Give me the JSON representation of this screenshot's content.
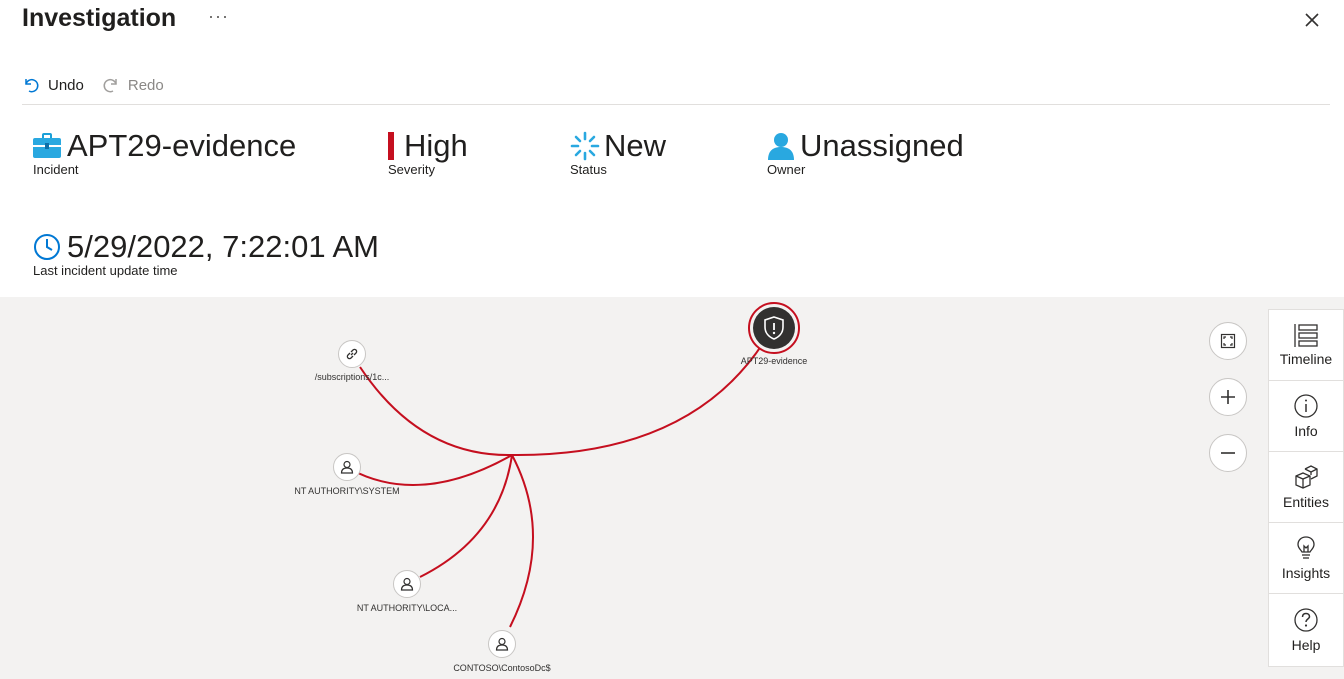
{
  "header": {
    "title": "Investigation",
    "more": "···"
  },
  "toolbar": {
    "undo": "Undo",
    "redo": "Redo"
  },
  "incident": {
    "name": "APT29-evidence",
    "name_label": "Incident",
    "severity": "High",
    "severity_label": "Severity",
    "severity_color": "#c50f1f",
    "status": "New",
    "status_label": "Status",
    "owner": "Unassigned",
    "owner_label": "Owner",
    "update_time": "5/29/2022, 7:22:01 AM",
    "update_time_label": "Last incident update time"
  },
  "graph": {
    "edge_color": "#c50f1f",
    "nodes": [
      {
        "label": "APT29-evidence",
        "icon": "shield-alert-icon"
      },
      {
        "label": "/subscriptions/1c...",
        "icon": "link-icon"
      },
      {
        "label": "NT AUTHORITY\\SYSTEM",
        "icon": "user-icon"
      },
      {
        "label": "NT AUTHORITY\\LOCA...",
        "icon": "user-icon"
      },
      {
        "label": "CONTOSO\\ContosoDc$",
        "icon": "user-icon"
      }
    ]
  },
  "side_panel": {
    "items": [
      {
        "label": "Timeline",
        "icon": "timeline-icon"
      },
      {
        "label": "Info",
        "icon": "info-icon"
      },
      {
        "label": "Entities",
        "icon": "entities-icon"
      },
      {
        "label": "Insights",
        "icon": "lightbulb-icon"
      },
      {
        "label": "Help",
        "icon": "help-icon"
      }
    ]
  }
}
